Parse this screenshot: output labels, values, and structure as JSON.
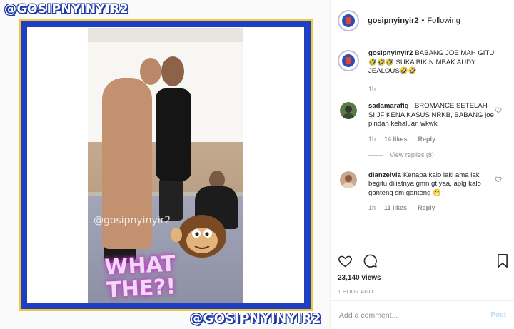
{
  "media": {
    "watermark_top": "@GOSIPNYINYIR2",
    "watermark_bottom": "@GOSIPNYINYIR2",
    "video_watermark": "@gosipnyinyir2",
    "sticker_text_1": "WHAT",
    "sticker_text_2": "THE?!"
  },
  "header": {
    "username": "gosipnyinyir2",
    "separator": "•",
    "follow_status": "Following"
  },
  "caption": {
    "username": "gosipnyinyir2",
    "text": "BABANG JOE MAH GITU 🤣🤣🤣 SUKA BIKIN MBAK AUDY JEALOUS🤣🤣",
    "time": "1h"
  },
  "comments": [
    {
      "username": "sadamarafiq_",
      "text": "BROMANCE SETELAH SI JF KENA KASUS NRKB, BABANG joe pindah kehaluan wkwk",
      "time": "1h",
      "likes": "14 likes",
      "reply_label": "Reply",
      "view_replies": "View replies (8)"
    },
    {
      "username": "dianzelvia",
      "text": "Kenapa kalo laki ama laki begitu diliatnya gmn gt yaa, aplg kalo ganteng sm ganteng 😁",
      "time": "1h",
      "likes": "11 likes",
      "reply_label": "Reply"
    }
  ],
  "stats": {
    "views": "23,140 views",
    "posted": "1 HOUR AGO"
  },
  "add_comment": {
    "placeholder": "Add a comment...",
    "post_label": "Post"
  },
  "colors": {
    "frame_blue": "#1e3fc4",
    "frame_yellow": "#f2c83a",
    "link_blue": "#b2dffc"
  }
}
